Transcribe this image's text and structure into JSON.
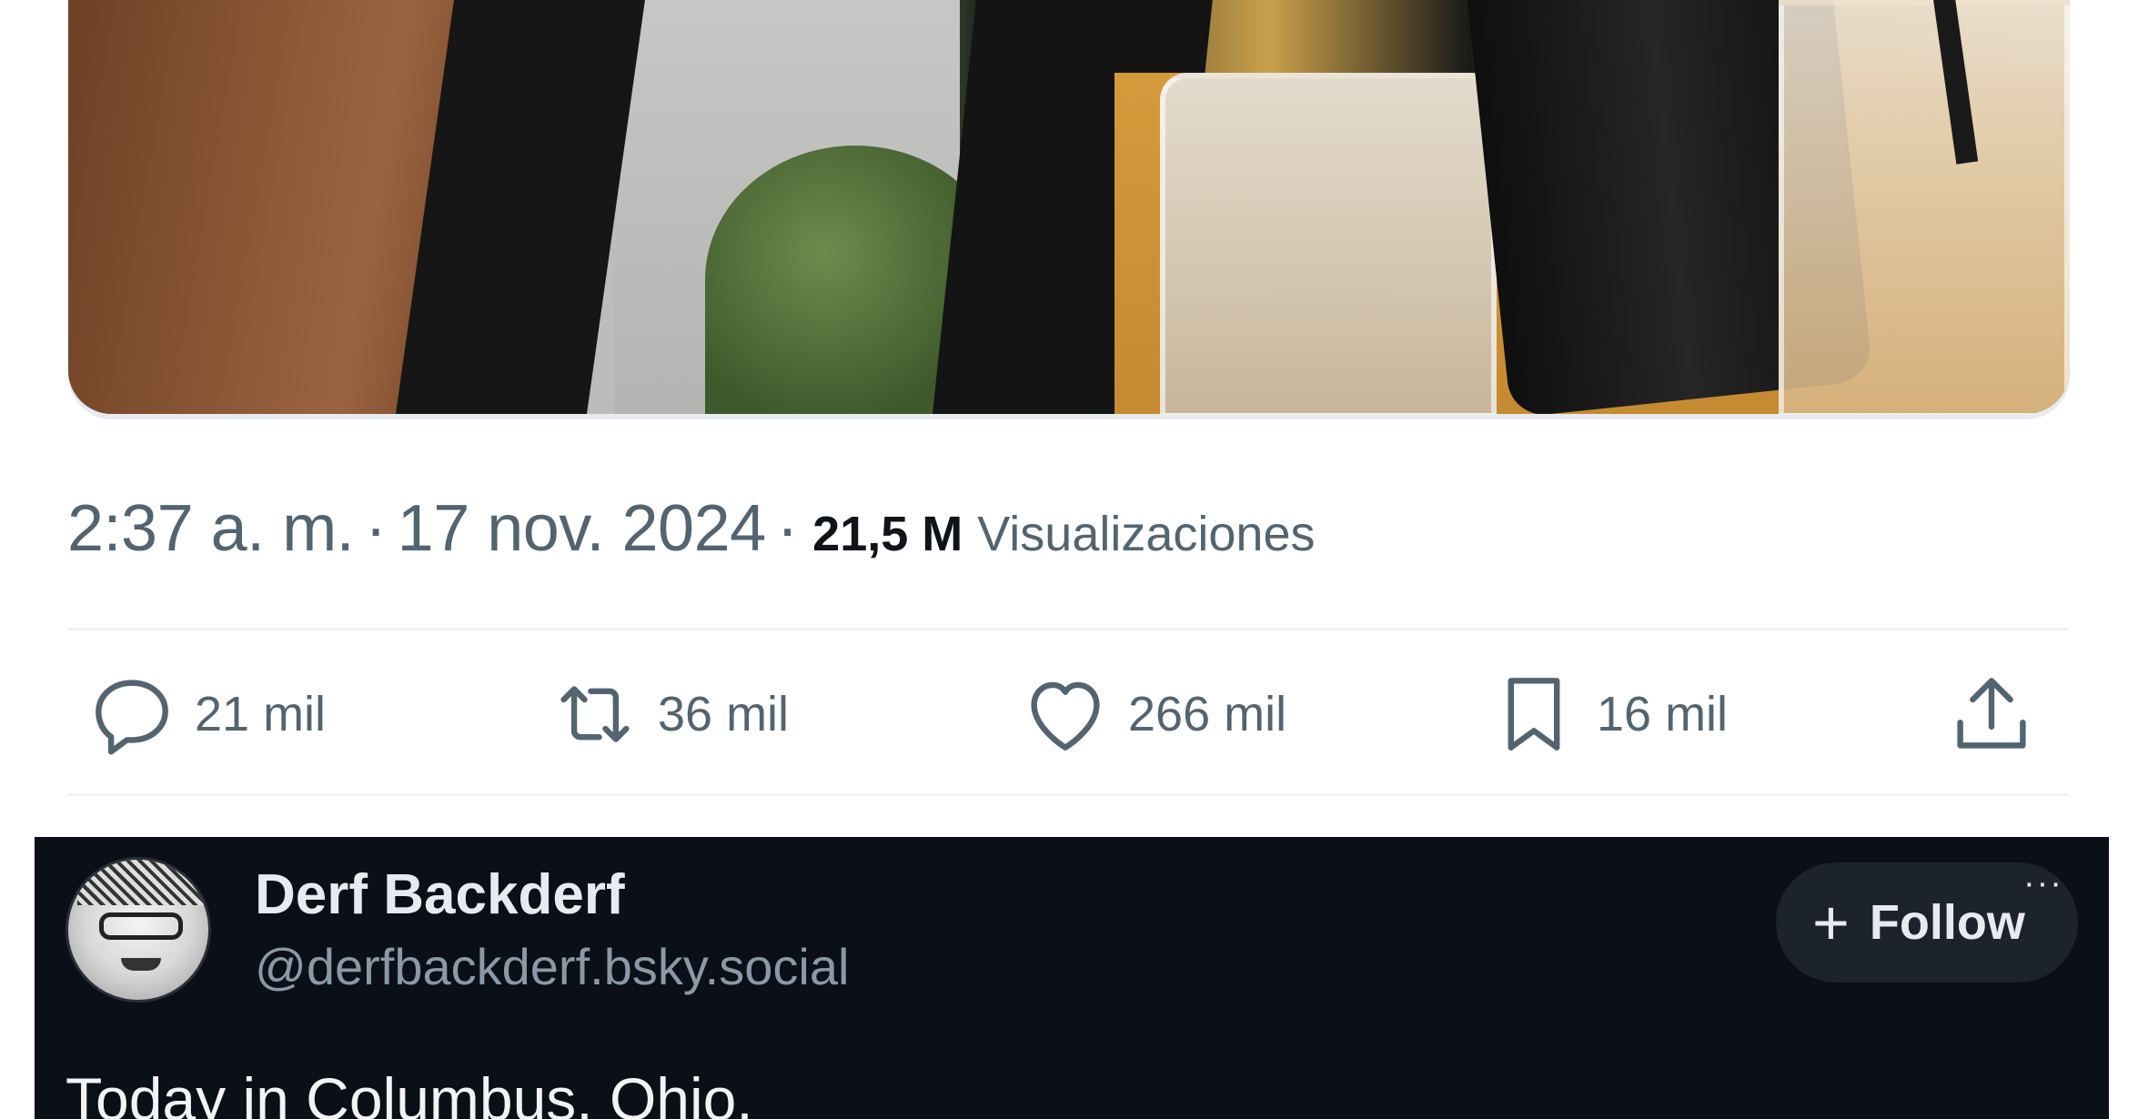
{
  "tweet": {
    "time": "2:37 a. m.",
    "separator": "·",
    "date": "17 nov. 2024",
    "views_count": "21,5 M",
    "views_label": "Visualizaciones",
    "actions": {
      "reply": {
        "icon": "comment-bubble-icon",
        "count": "21 mil"
      },
      "retweet": {
        "icon": "retweet-arrows-icon",
        "count": "36 mil"
      },
      "like": {
        "icon": "heart-icon",
        "count": "266 mil"
      },
      "bookmark": {
        "icon": "bookmark-icon",
        "count": "16 mil"
      },
      "share": {
        "icon": "share-upload-icon"
      }
    }
  },
  "embedded_post": {
    "name": "Derf Backderf",
    "handle": "@derfbackderf.bsky.social",
    "follow_label": "Follow",
    "more_label": "···",
    "text": "Today in Columbus, Ohio."
  },
  "colors": {
    "muted_text": "#536471",
    "primary_text": "#0f1419",
    "divider": "#eff3f4",
    "bsky_background": "#0a0f18",
    "bsky_button": "#1c232d"
  }
}
